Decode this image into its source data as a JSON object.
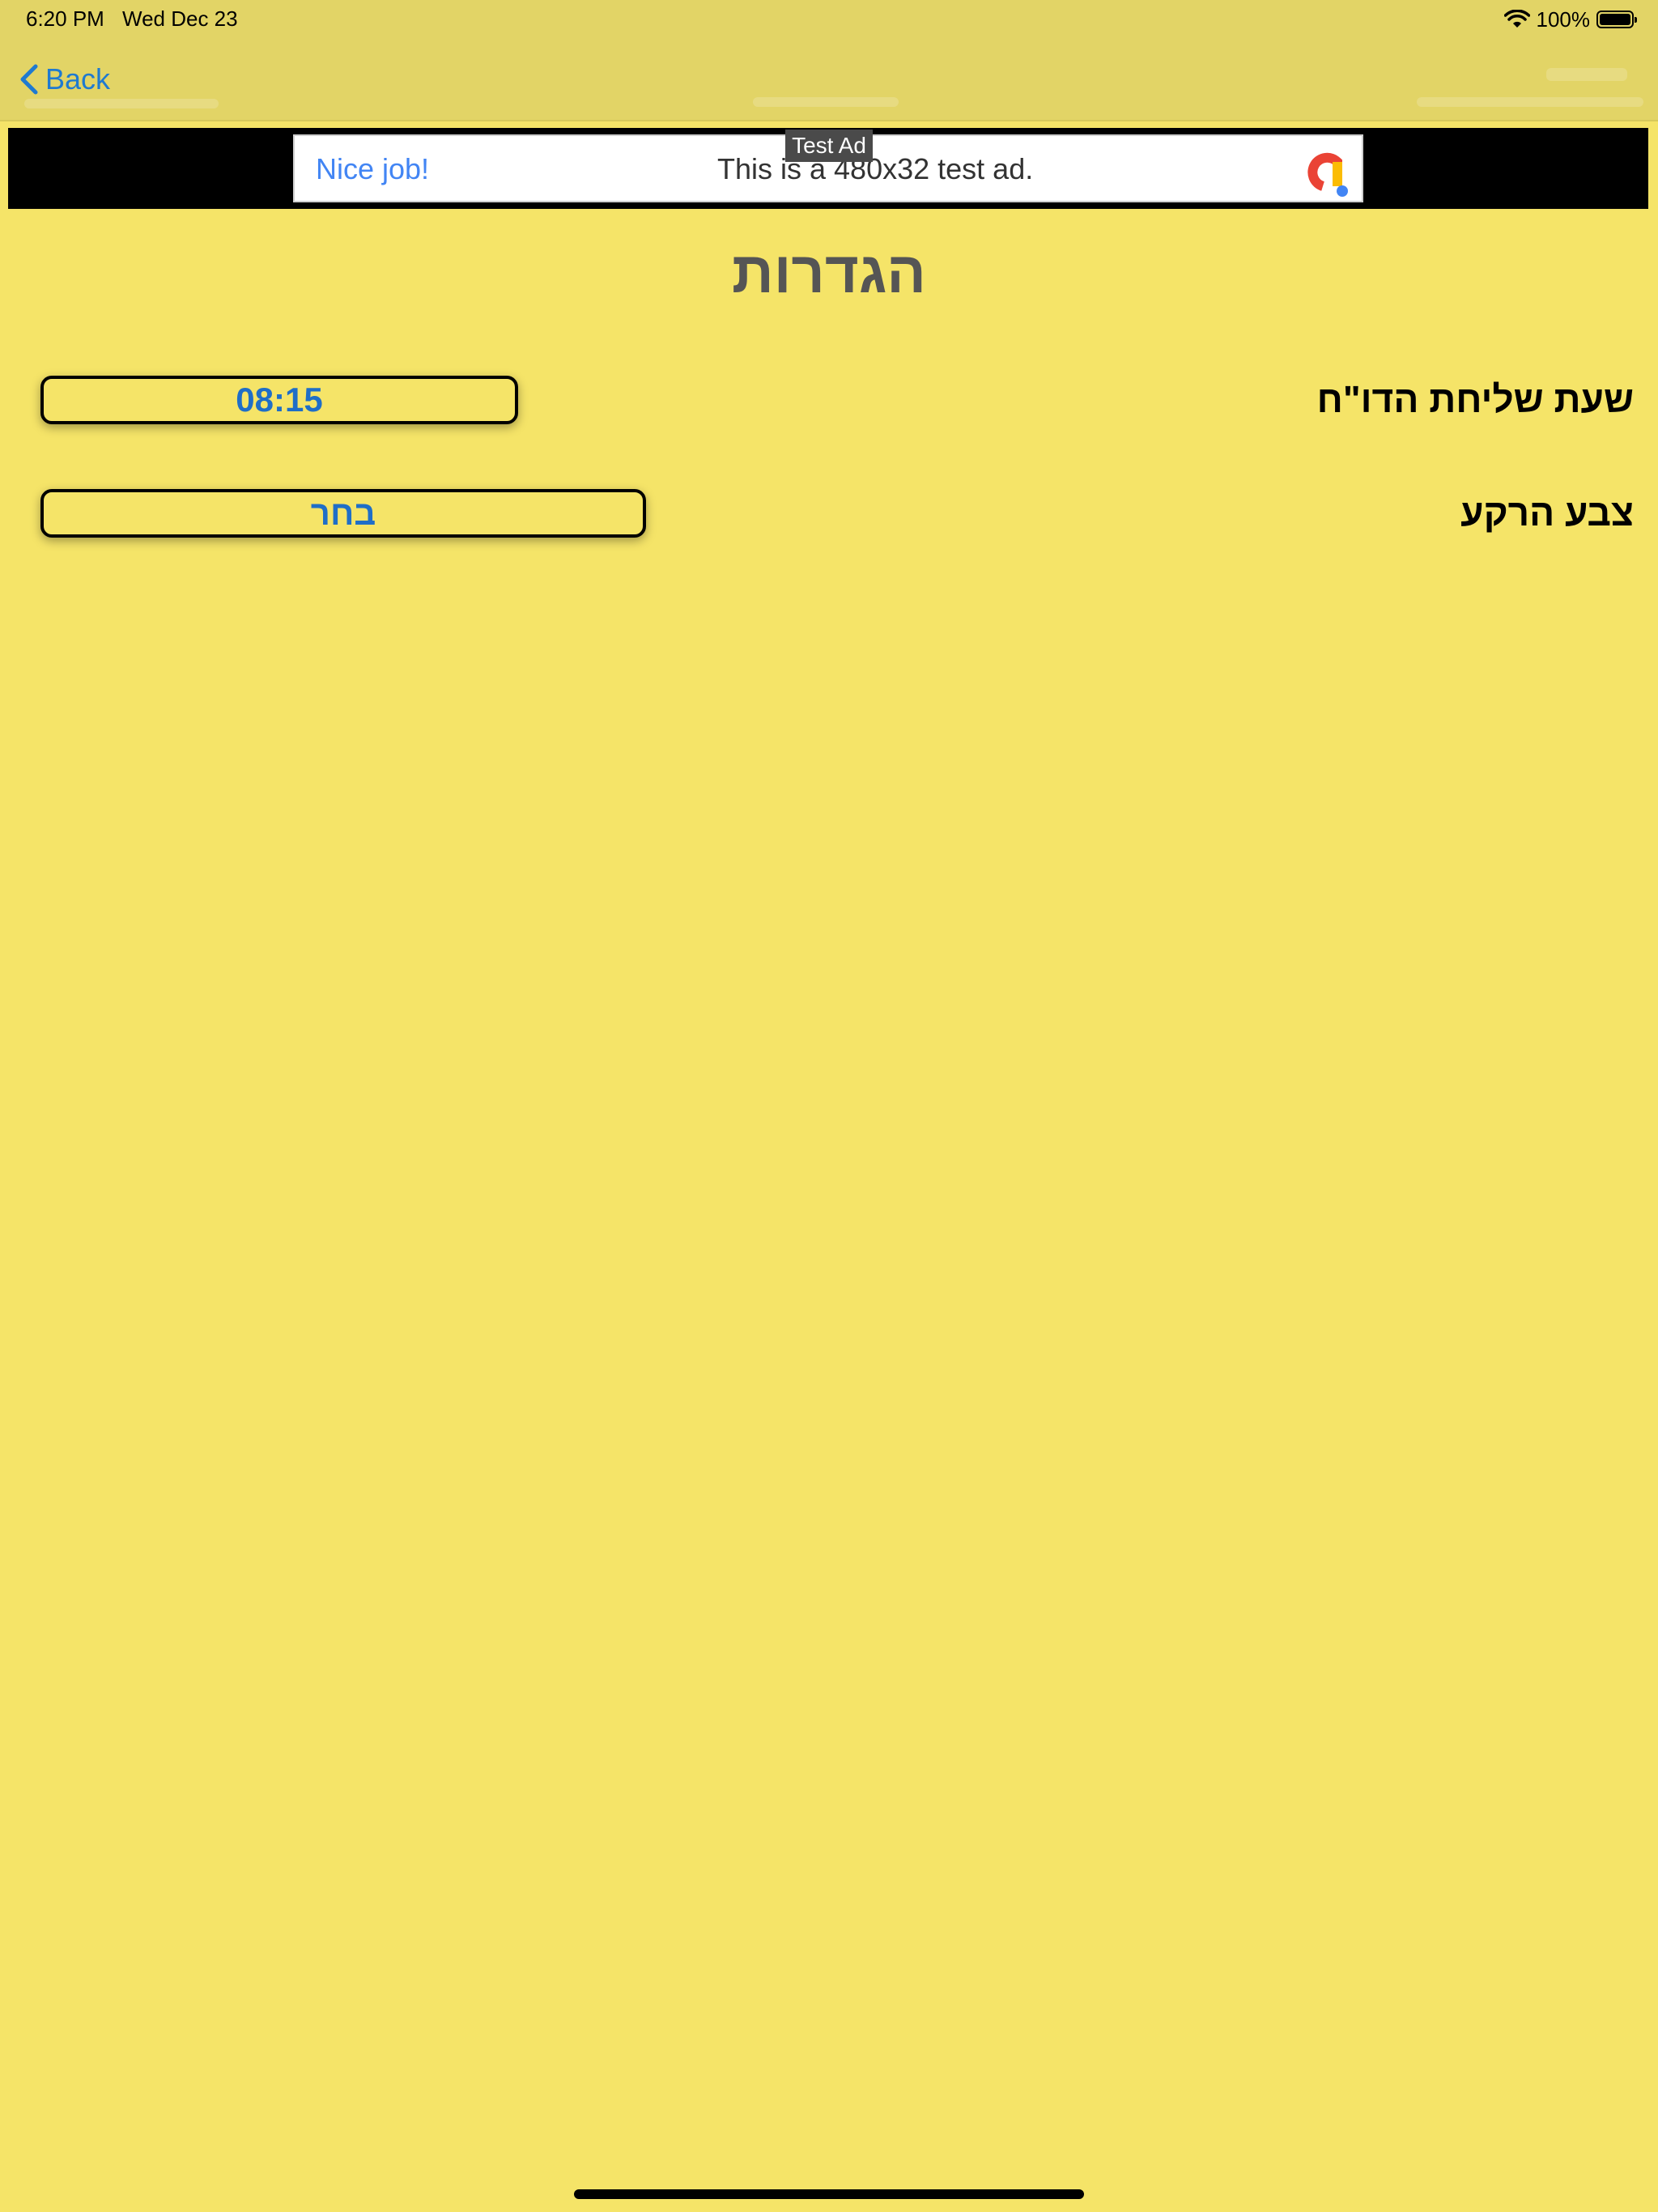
{
  "status_bar": {
    "time": "6:20 PM",
    "date": "Wed Dec 23",
    "battery": "100%"
  },
  "nav": {
    "back_label": "Back"
  },
  "ad": {
    "badge": "Test Ad",
    "headline": "Nice job!",
    "body": "This is a 480x32 test ad."
  },
  "settings": {
    "title": "הגדרות",
    "report_time_label": "שעת שליחת הדו\"ח",
    "report_time_value": "08:15",
    "background_color_label": "צבע הרקע",
    "background_color_button": "בחר"
  },
  "colors": {
    "background": "#f5e468",
    "nav_bar": "#e2d466",
    "accent": "#1f6ec7",
    "title": "#555555"
  }
}
